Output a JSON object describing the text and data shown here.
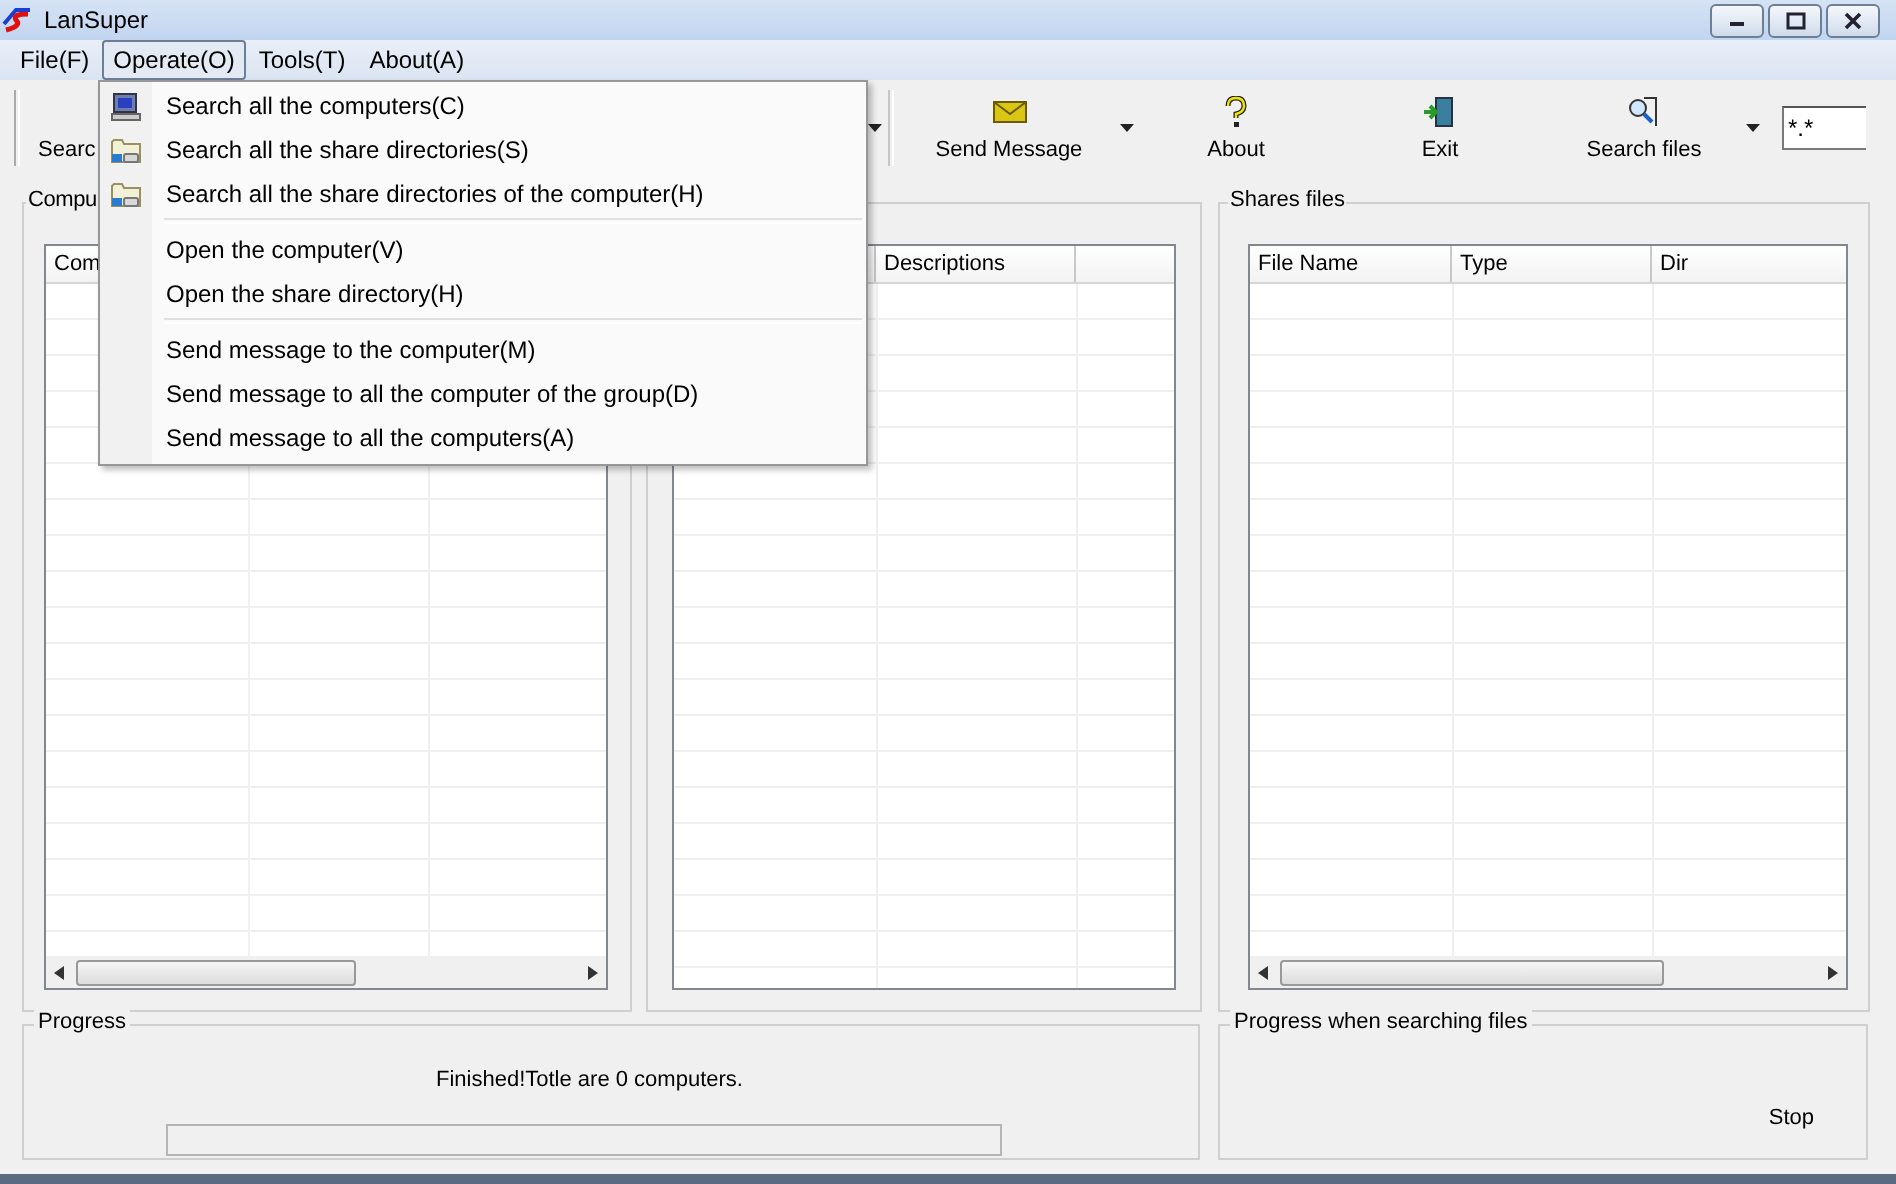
{
  "window": {
    "title": "LanSuper"
  },
  "menu_bar": [
    {
      "label": "File(F)",
      "selected": false
    },
    {
      "label": "Operate(O)",
      "selected": true
    },
    {
      "label": "Tools(T)",
      "selected": false
    },
    {
      "label": "About(A)",
      "selected": false
    }
  ],
  "toolbar": {
    "buttons": [
      {
        "label": "Searc",
        "kind": "hidden",
        "dropdown": true
      },
      {
        "label": "Send Message",
        "kind": "message",
        "dropdown": true
      },
      {
        "label": "About",
        "kind": "help",
        "dropdown": false
      },
      {
        "label": "Exit",
        "kind": "exit",
        "dropdown": false
      },
      {
        "label": "Search files",
        "kind": "find",
        "dropdown": true
      }
    ],
    "filter": {
      "value": "*.*"
    }
  },
  "panels": [
    {
      "title": "Compu",
      "columns": [
        "Com"
      ],
      "scrollbar": true
    },
    {
      "columns": [
        "Descriptions"
      ],
      "scrollbar": false
    },
    {
      "title": "Shares files",
      "columns": [
        "File Name",
        "Type",
        "Dir"
      ],
      "scrollbar": true
    }
  ],
  "progress": {
    "title": "Progress",
    "message": "Finished!Totle are 0 computers.",
    "level": 0
  },
  "file_progress": {
    "title": "Progress when searching files",
    "stop": "Stop"
  },
  "open_menu": {
    "groups": [
      [
        {
          "label": "Search all the computers(C)",
          "kind": "computer"
        },
        {
          "label": "Search all the share directories(S)",
          "kind": "folder"
        },
        {
          "label": "Search all the share directories of the computer(H)",
          "kind": "folder"
        }
      ],
      [
        {
          "label": "Open the computer(V)",
          "kind": "plain"
        },
        {
          "label": "Open the share directory(H)",
          "kind": "plain"
        }
      ],
      [
        {
          "label": "Send message to the computer(M)",
          "kind": "plain"
        },
        {
          "label": "Send message to all the computer of the group(D)",
          "kind": "plain"
        },
        {
          "label": "Send message to all the computers(A)",
          "kind": "plain"
        }
      ]
    ]
  }
}
